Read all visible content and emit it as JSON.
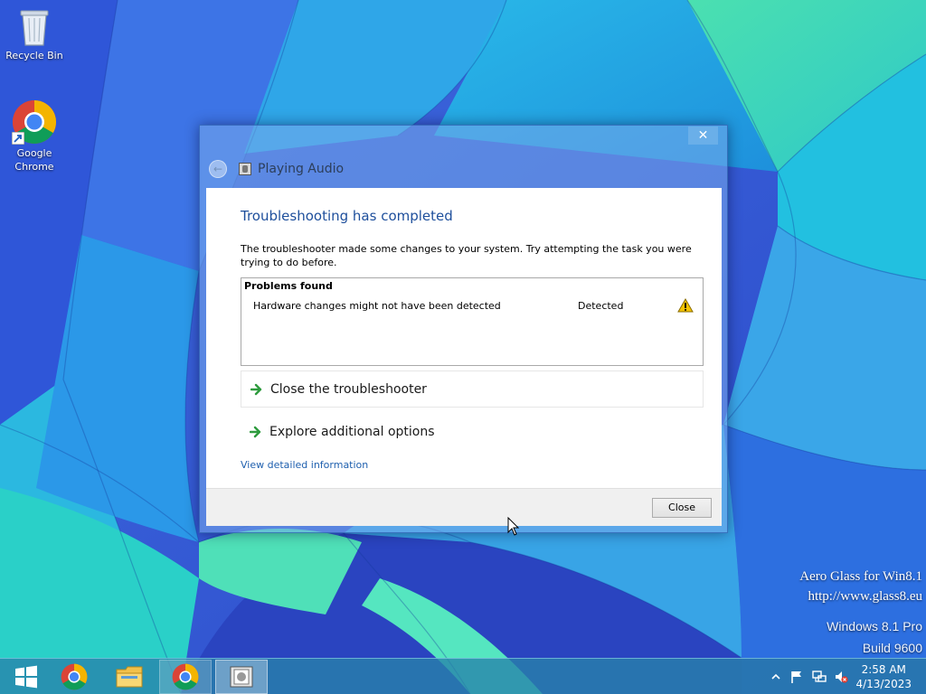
{
  "desktop": {
    "icons": [
      {
        "label": "Recycle Bin"
      },
      {
        "label_line1": "Google",
        "label_line2": "Chrome"
      }
    ],
    "watermark": {
      "line1": "Aero Glass for Win8.1",
      "line2": "http://www.glass8.eu",
      "line3": "Windows 8.1 Pro",
      "line4": "Build 9600"
    }
  },
  "window": {
    "close_glyph": "✕",
    "nav_title": "Playing Audio",
    "heading": "Troubleshooting has completed",
    "description": "The troubleshooter made some changes to your system. Try attempting the task you were trying to do before.",
    "problems": {
      "title": "Problems found",
      "items": [
        {
          "name": "Hardware changes might not have been detected",
          "status": "Detected",
          "icon": "warning-icon"
        }
      ]
    },
    "options": [
      {
        "label": "Close the troubleshooter",
        "icon": "green-arrow-icon"
      },
      {
        "label": "Explore additional options",
        "icon": "green-arrow-icon"
      }
    ],
    "detail_link": "View detailed information",
    "footer": {
      "close_button": "Close"
    }
  },
  "taskbar": {
    "items": [
      "start-icon",
      "chrome-icon",
      "file-explorer-icon",
      "chrome-icon",
      "audio-troubleshooter-icon"
    ],
    "tray": [
      "show-hidden-icons-chevron",
      "action-center-flag-icon",
      "network-icon",
      "volume-muted-icon"
    ],
    "clock": {
      "time": "2:58 AM",
      "date": "4/13/2023"
    }
  },
  "colors": {
    "heading": "#1e4f9c",
    "link": "#1e5fae",
    "taskbar": "#2882aa",
    "arrow": "#2e9b3e",
    "warning": "#f5c400"
  }
}
